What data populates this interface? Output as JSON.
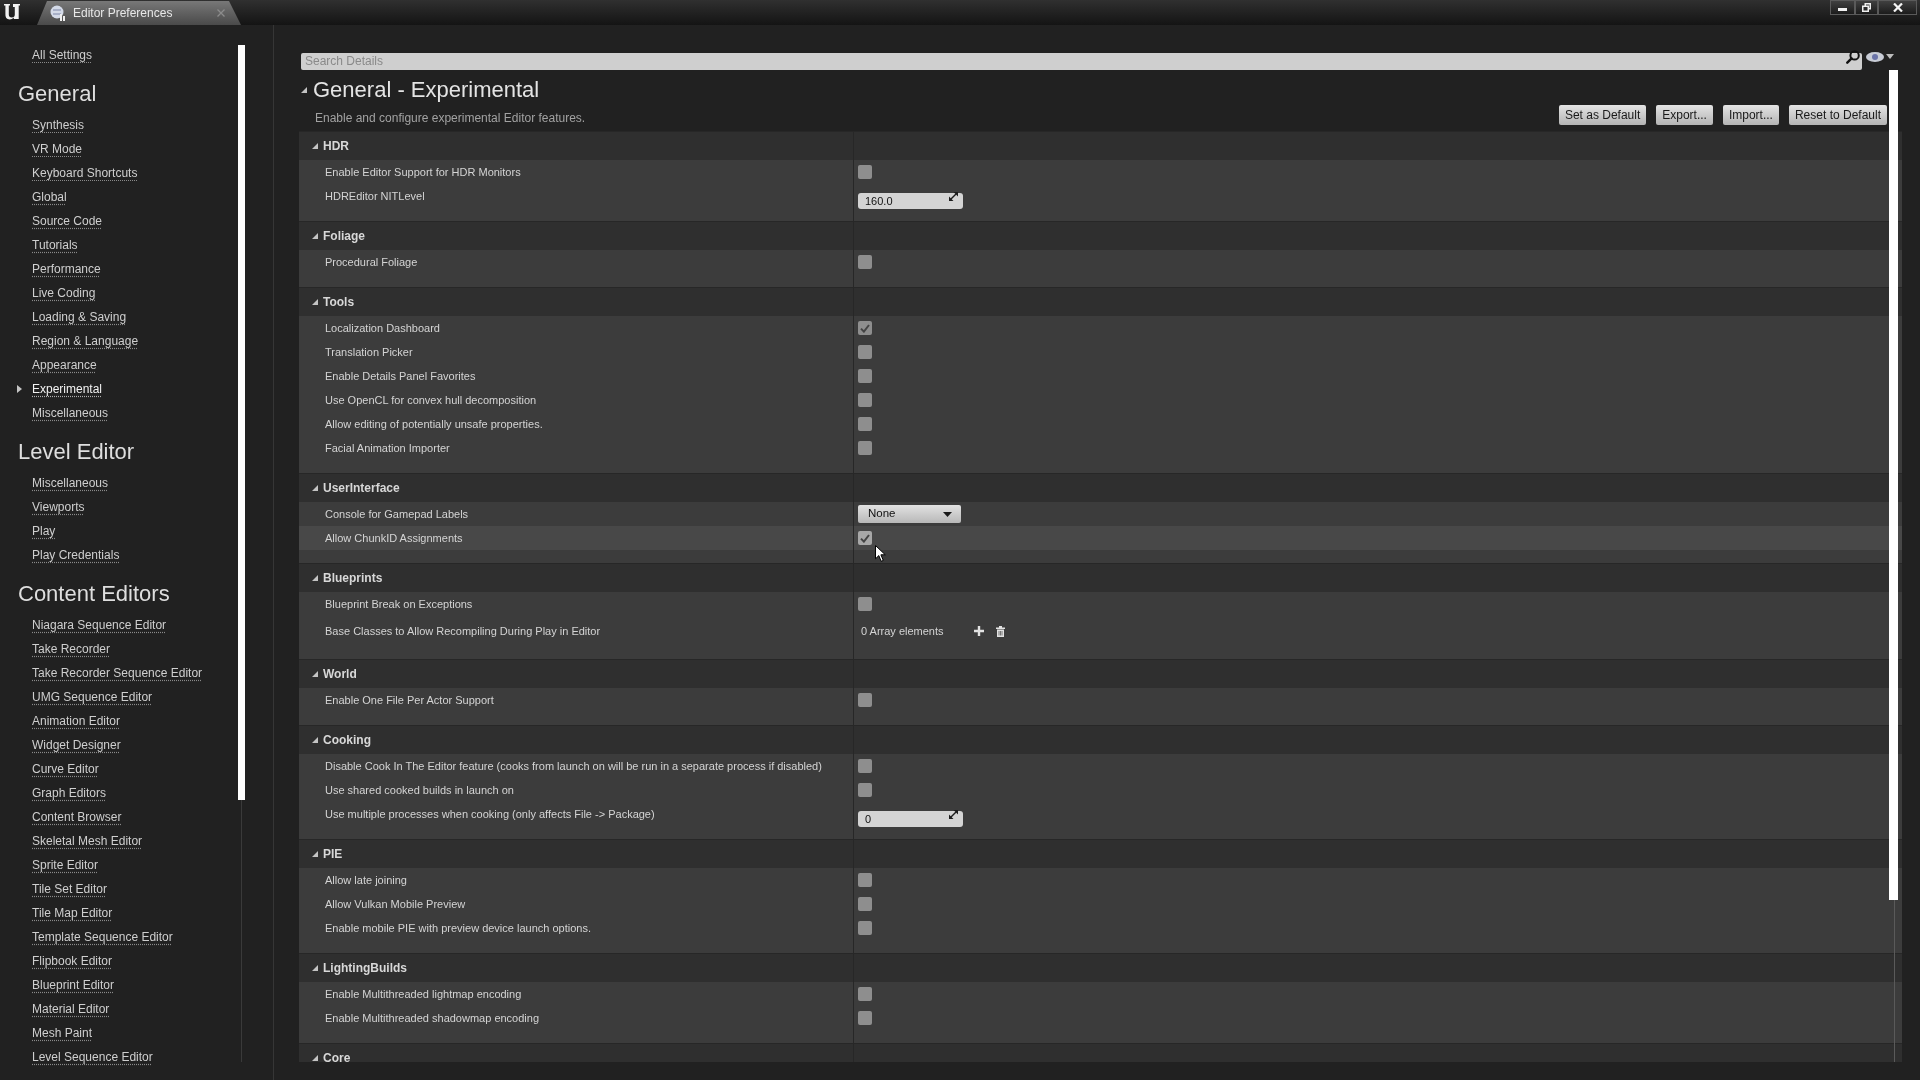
{
  "window": {
    "tab": {
      "title": "Editor Preferences"
    }
  },
  "sidebar": {
    "top_items": [
      {
        "label": "All Settings",
        "selected": false
      }
    ],
    "sections": [
      {
        "title": "General",
        "items": [
          {
            "label": "Synthesis",
            "selected": false
          },
          {
            "label": "VR Mode",
            "selected": false
          },
          {
            "label": "Keyboard Shortcuts",
            "selected": false
          },
          {
            "label": "Global",
            "selected": false
          },
          {
            "label": "Source Code",
            "selected": false
          },
          {
            "label": "Tutorials",
            "selected": false
          },
          {
            "label": "Performance",
            "selected": false
          },
          {
            "label": "Live Coding",
            "selected": false
          },
          {
            "label": "Loading & Saving",
            "selected": false
          },
          {
            "label": "Region & Language",
            "selected": false
          },
          {
            "label": "Appearance",
            "selected": false
          },
          {
            "label": "Experimental",
            "selected": true
          },
          {
            "label": "Miscellaneous",
            "selected": false
          }
        ]
      },
      {
        "title": "Level Editor",
        "items": [
          {
            "label": "Miscellaneous",
            "selected": false
          },
          {
            "label": "Viewports",
            "selected": false
          },
          {
            "label": "Play",
            "selected": false
          },
          {
            "label": "Play Credentials",
            "selected": false
          }
        ]
      },
      {
        "title": "Content Editors",
        "items": [
          {
            "label": "Niagara Sequence Editor",
            "selected": false
          },
          {
            "label": "Take Recorder",
            "selected": false
          },
          {
            "label": "Take Recorder Sequence Editor",
            "selected": false
          },
          {
            "label": "UMG Sequence Editor",
            "selected": false
          },
          {
            "label": "Animation Editor",
            "selected": false
          },
          {
            "label": "Widget Designer",
            "selected": false
          },
          {
            "label": "Curve Editor",
            "selected": false
          },
          {
            "label": "Graph Editors",
            "selected": false
          },
          {
            "label": "Content Browser",
            "selected": false
          },
          {
            "label": "Skeletal Mesh Editor",
            "selected": false
          },
          {
            "label": "Sprite Editor",
            "selected": false
          },
          {
            "label": "Tile Set Editor",
            "selected": false
          },
          {
            "label": "Tile Map Editor",
            "selected": false
          },
          {
            "label": "Template Sequence Editor",
            "selected": false
          },
          {
            "label": "Flipbook Editor",
            "selected": false
          },
          {
            "label": "Blueprint Editor",
            "selected": false
          },
          {
            "label": "Material Editor",
            "selected": false
          },
          {
            "label": "Mesh Paint",
            "selected": false
          },
          {
            "label": "Level Sequence Editor",
            "selected": false
          }
        ]
      }
    ]
  },
  "details": {
    "search": {
      "placeholder": "Search Details"
    },
    "title": "General - Experimental",
    "expanded": true,
    "description": "Enable and configure experimental Editor features.",
    "buttons": [
      "Set as Default",
      "Export...",
      "Import...",
      "Reset to Default"
    ],
    "categories": [
      {
        "title": "HDR",
        "expanded": true,
        "rows": [
          {
            "label": "Enable Editor Support for HDR Monitors",
            "kind": "checkbox",
            "checked": false,
            "hovered": false
          },
          {
            "label": "HDREditor NITLevel",
            "kind": "number",
            "value": "160.0",
            "hovered": false
          }
        ]
      },
      {
        "title": "Foliage",
        "expanded": true,
        "rows": [
          {
            "label": "Procedural Foliage",
            "kind": "checkbox",
            "checked": false,
            "hovered": false
          }
        ]
      },
      {
        "title": "Tools",
        "expanded": true,
        "rows": [
          {
            "label": "Localization Dashboard",
            "kind": "checkbox",
            "checked": true,
            "hovered": false
          },
          {
            "label": "Translation Picker",
            "kind": "checkbox",
            "checked": false,
            "hovered": false
          },
          {
            "label": "Enable Details Panel Favorites",
            "kind": "checkbox",
            "checked": false,
            "hovered": false
          },
          {
            "label": "Use OpenCL for convex hull decomposition",
            "kind": "checkbox",
            "checked": false,
            "hovered": false
          },
          {
            "label": "Allow editing of potentially unsafe properties.",
            "kind": "checkbox",
            "checked": false,
            "hovered": false
          },
          {
            "label": "Facial Animation Importer",
            "kind": "checkbox",
            "checked": false,
            "hovered": false
          }
        ]
      },
      {
        "title": "UserInterface",
        "expanded": true,
        "rows": [
          {
            "label": "Console for Gamepad Labels",
            "kind": "dropdown",
            "value": "None",
            "hovered": false
          },
          {
            "label": "Allow ChunkID Assignments",
            "kind": "checkbox",
            "checked": true,
            "hovered": true
          }
        ]
      },
      {
        "title": "Blueprints",
        "expanded": true,
        "rows": [
          {
            "label": "Blueprint Break on Exceptions",
            "kind": "checkbox",
            "checked": false,
            "hovered": false
          },
          {
            "label": "Base Classes to Allow Recompiling During Play in Editor",
            "kind": "array",
            "value": "0 Array elements",
            "hovered": false
          }
        ]
      },
      {
        "title": "World",
        "expanded": true,
        "rows": [
          {
            "label": "Enable One File Per Actor Support",
            "kind": "checkbox",
            "checked": false,
            "hovered": false
          }
        ]
      },
      {
        "title": "Cooking",
        "expanded": true,
        "rows": [
          {
            "label": "Disable Cook In The Editor feature (cooks from launch on will be run in a separate process if disabled)",
            "kind": "checkbox",
            "checked": false,
            "hovered": false
          },
          {
            "label": "Use shared cooked builds in launch on",
            "kind": "checkbox",
            "checked": false,
            "hovered": false
          },
          {
            "label": "Use multiple processes when cooking (only affects File -> Package)",
            "kind": "number",
            "value": "0",
            "hovered": false
          }
        ]
      },
      {
        "title": "PIE",
        "expanded": true,
        "rows": [
          {
            "label": "Allow late joining",
            "kind": "checkbox",
            "checked": false,
            "hovered": false
          },
          {
            "label": "Allow Vulkan Mobile Preview",
            "kind": "checkbox",
            "checked": false,
            "hovered": false
          },
          {
            "label": "Enable mobile PIE with preview device launch options.",
            "kind": "checkbox",
            "checked": false,
            "hovered": false
          }
        ]
      },
      {
        "title": "LightingBuilds",
        "expanded": true,
        "rows": [
          {
            "label": "Enable Multithreaded lightmap encoding",
            "kind": "checkbox",
            "checked": false,
            "hovered": false
          },
          {
            "label": "Enable Multithreaded shadowmap encoding",
            "kind": "checkbox",
            "checked": false,
            "hovered": false
          }
        ]
      },
      {
        "title": "Core",
        "expanded": true
      }
    ]
  }
}
